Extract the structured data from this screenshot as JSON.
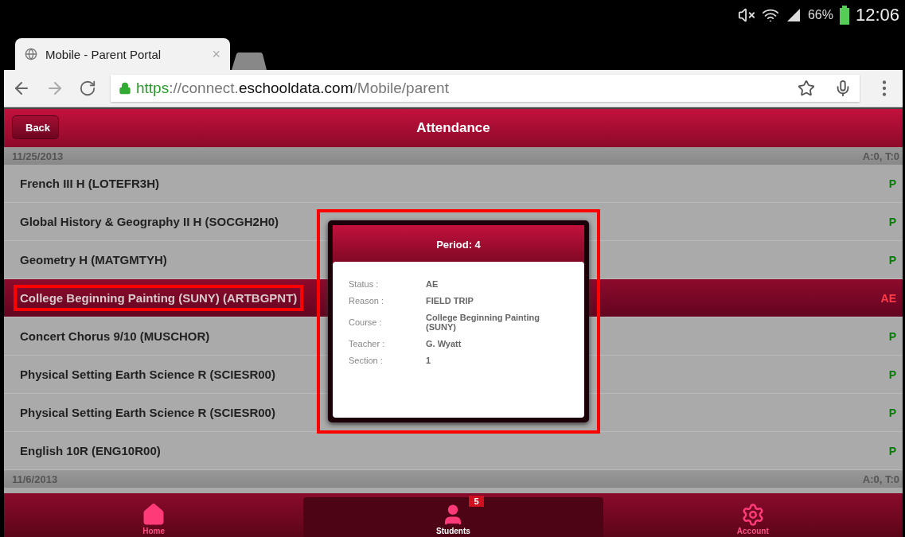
{
  "status_bar": {
    "battery": "66%",
    "time": "12:06"
  },
  "browser_tab": {
    "title": "Mobile - Parent Portal",
    "close": "×",
    "selected": true
  },
  "address_bar": {
    "url": [
      {
        "kind": "scheme",
        "text": "https"
      },
      {
        "kind": "faint",
        "text": "://connect."
      },
      {
        "kind": "domain",
        "text": "eschooldata.com"
      },
      {
        "kind": "faint",
        "text": "/Mobile/parent"
      }
    ]
  },
  "header": {
    "back": "Back",
    "title": "Attendance"
  },
  "groups": [
    {
      "date": "11/25/2013",
      "summary": "A:0, T:0",
      "rows": [
        {
          "course": "French III H (LOTEFR3H)",
          "code": "P",
          "selected": false
        },
        {
          "course": "Global History & Geography II H (SOCGH2H0)",
          "code": "P",
          "selected": false
        },
        {
          "course": "Geometry H (MATGMTYH)",
          "code": "P",
          "selected": false
        },
        {
          "course": "College Beginning Painting (SUNY) (ARTBGPNT)",
          "code": "AE",
          "selected": true
        },
        {
          "course": "Concert Chorus 9/10 (MUSCHOR)",
          "code": "P",
          "selected": false
        },
        {
          "course": "Physical Setting Earth Science R (SCIESR00)",
          "code": "P",
          "selected": false
        },
        {
          "course": "Physical Setting Earth Science R (SCIESR00)",
          "code": "P",
          "selected": false
        },
        {
          "course": "English 10R (ENG10R00)",
          "code": "P",
          "selected": false
        }
      ]
    },
    {
      "date": "11/6/2013",
      "summary": "A:0, T:0"
    }
  ],
  "popup": {
    "title": "Period: 4",
    "fields": [
      {
        "label": "Status :",
        "value": "AE"
      },
      {
        "label": "Reason :",
        "value": "FIELD TRIP"
      },
      {
        "label": "Course :",
        "value": "College Beginning Painting (SUNY)"
      },
      {
        "label": "Teacher :",
        "value": "G. Wyatt"
      },
      {
        "label": "Section :",
        "value": "1"
      }
    ]
  },
  "bottom_nav": [
    {
      "kind": "home",
      "label": "Home",
      "selected": false
    },
    {
      "kind": "students",
      "label": "Students",
      "badge": "5",
      "selected": true
    },
    {
      "kind": "account",
      "label": "Account",
      "selected": false
    }
  ]
}
